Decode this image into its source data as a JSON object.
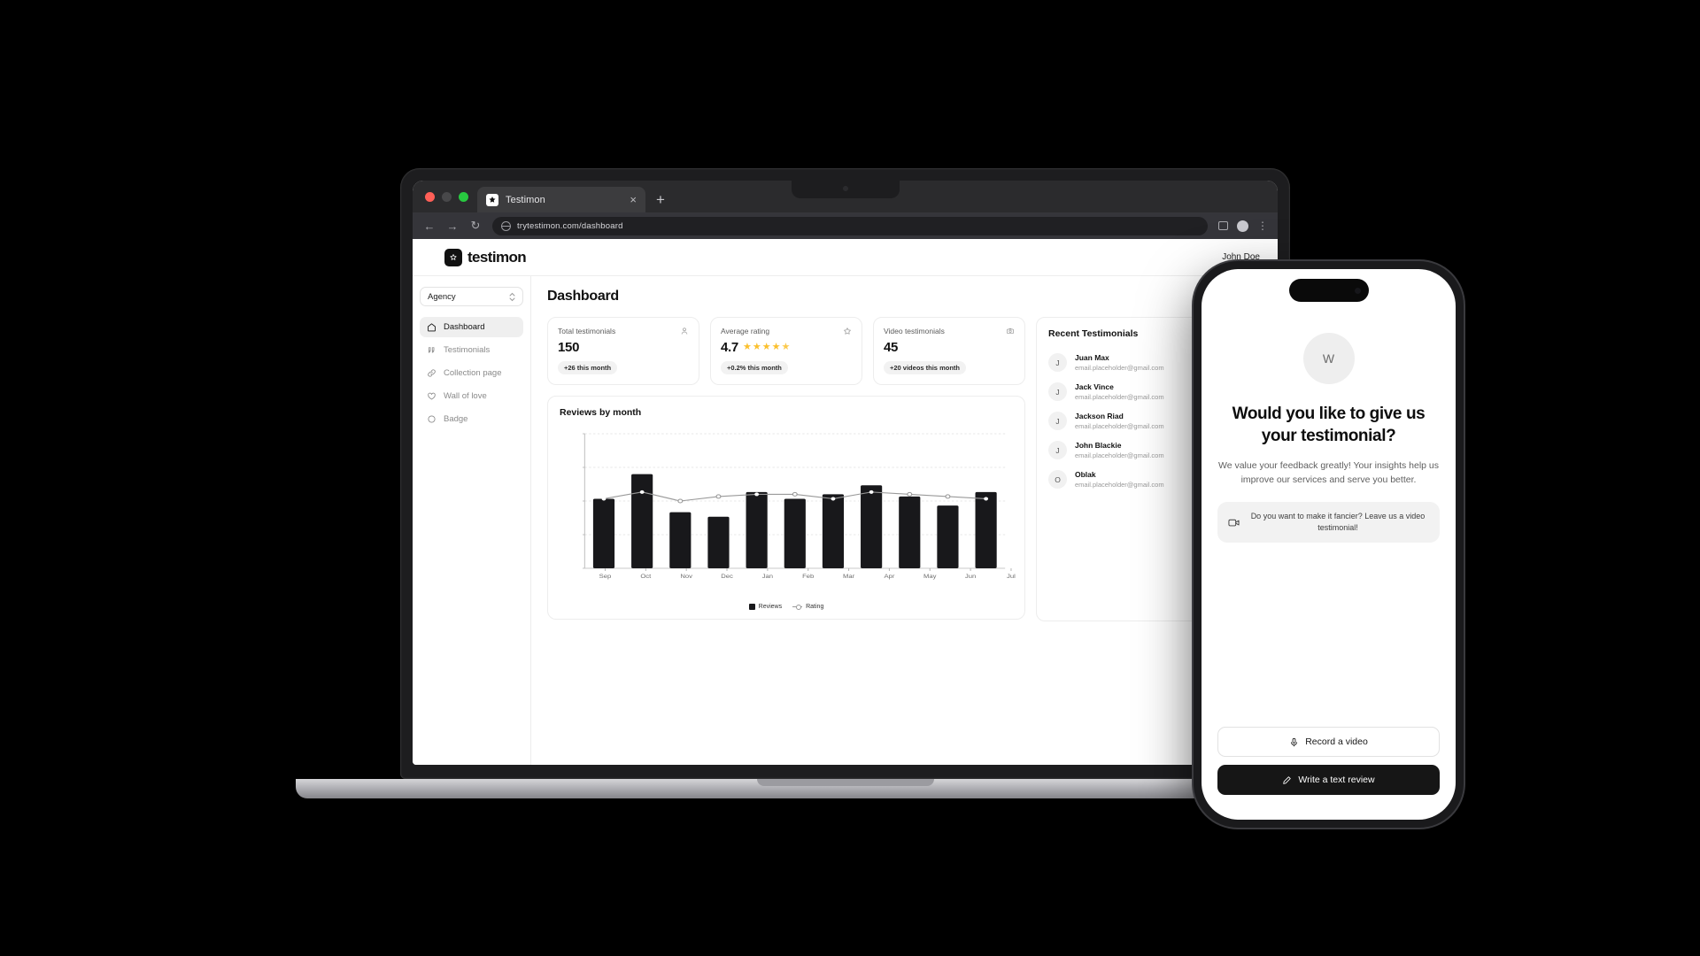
{
  "browser": {
    "tab_title": "Testimon",
    "tab_close": "×",
    "new_tab": "+",
    "back_icon": "←",
    "forward_icon": "→",
    "reload_icon": "↻",
    "url": "trytestimon.com/dashboard",
    "menu_icon": "⋮",
    "chevron_icon": "⌄"
  },
  "app": {
    "logo_text": "testimon",
    "logo_mark": "star-badge-icon",
    "user_name": "John Doe"
  },
  "sidebar": {
    "workspace": "Agency",
    "items": [
      {
        "label": "Dashboard",
        "icon": "home-icon",
        "active": true
      },
      {
        "label": "Testimonials",
        "icon": "quote-icon",
        "active": false
      },
      {
        "label": "Collection page",
        "icon": "link-icon",
        "active": false
      },
      {
        "label": "Wall of love",
        "icon": "heart-icon",
        "active": false
      },
      {
        "label": "Badge",
        "icon": "circle-icon",
        "active": false
      }
    ]
  },
  "main": {
    "page_title": "Dashboard",
    "stats": [
      {
        "label": "Total testimonials",
        "value": "150",
        "badge": "+26 this month",
        "icon": "user-icon"
      },
      {
        "label": "Average rating",
        "value": "4.7",
        "badge": "+0.2% this month",
        "icon": "star-outline-icon",
        "stars": 5
      },
      {
        "label": "Video testimonials",
        "value": "45",
        "badge": "+20 videos this month",
        "icon": "camera-icon"
      }
    ]
  },
  "chart_data": {
    "type": "bar",
    "title": "Reviews by month",
    "categories": [
      "Sep",
      "Oct",
      "Nov",
      "Dec",
      "Jan",
      "Feb",
      "Mar",
      "Apr",
      "May",
      "Jun",
      "Jul"
    ],
    "series": [
      {
        "name": "Reviews",
        "type": "bar",
        "values": [
          31,
          42,
          25,
          23,
          34,
          31,
          33,
          37,
          32,
          28,
          34
        ]
      },
      {
        "name": "Rating",
        "type": "line",
        "values": [
          31,
          34,
          30,
          32,
          33,
          33,
          31,
          34,
          33,
          32,
          31
        ]
      }
    ],
    "ylim": [
      0,
      60
    ],
    "yticks": [
      0,
      15,
      30,
      45,
      60
    ],
    "xlabel": "",
    "ylabel": "",
    "grid": true,
    "legend": [
      "Reviews",
      "Rating"
    ],
    "legend_position": "bottom"
  },
  "recent": {
    "title": "Recent Testimonials",
    "items": [
      {
        "initial": "J",
        "name": "Juan Max",
        "email": "email.placeholder@gmail.com",
        "star": "★"
      },
      {
        "initial": "J",
        "name": "Jack Vince",
        "email": "email.placeholder@gmail.com",
        "star": "★"
      },
      {
        "initial": "J",
        "name": "Jackson Riad",
        "email": "email.placeholder@gmail.com",
        "star": "★"
      },
      {
        "initial": "J",
        "name": "John Blackie",
        "email": "email.placeholder@gmail.com",
        "star": "★"
      },
      {
        "initial": "O",
        "name": "Oblak",
        "email": "email.placeholder@gmail.com",
        "star": "★"
      }
    ]
  },
  "phone": {
    "avatar_initial": "W",
    "heading": "Would you like to give us your testimonial?",
    "description": "We value your feedback greatly! Your insights help us improve our services and serve you better.",
    "note": "Do you want to make it fancier? Leave us a video testimonial!",
    "record_button": "Record a video",
    "write_button": "Write a text review"
  },
  "colors": {
    "accent_star": "#fbc02d",
    "bar": "#18181b",
    "line": "#9a9a9a",
    "dark": "#161616"
  }
}
